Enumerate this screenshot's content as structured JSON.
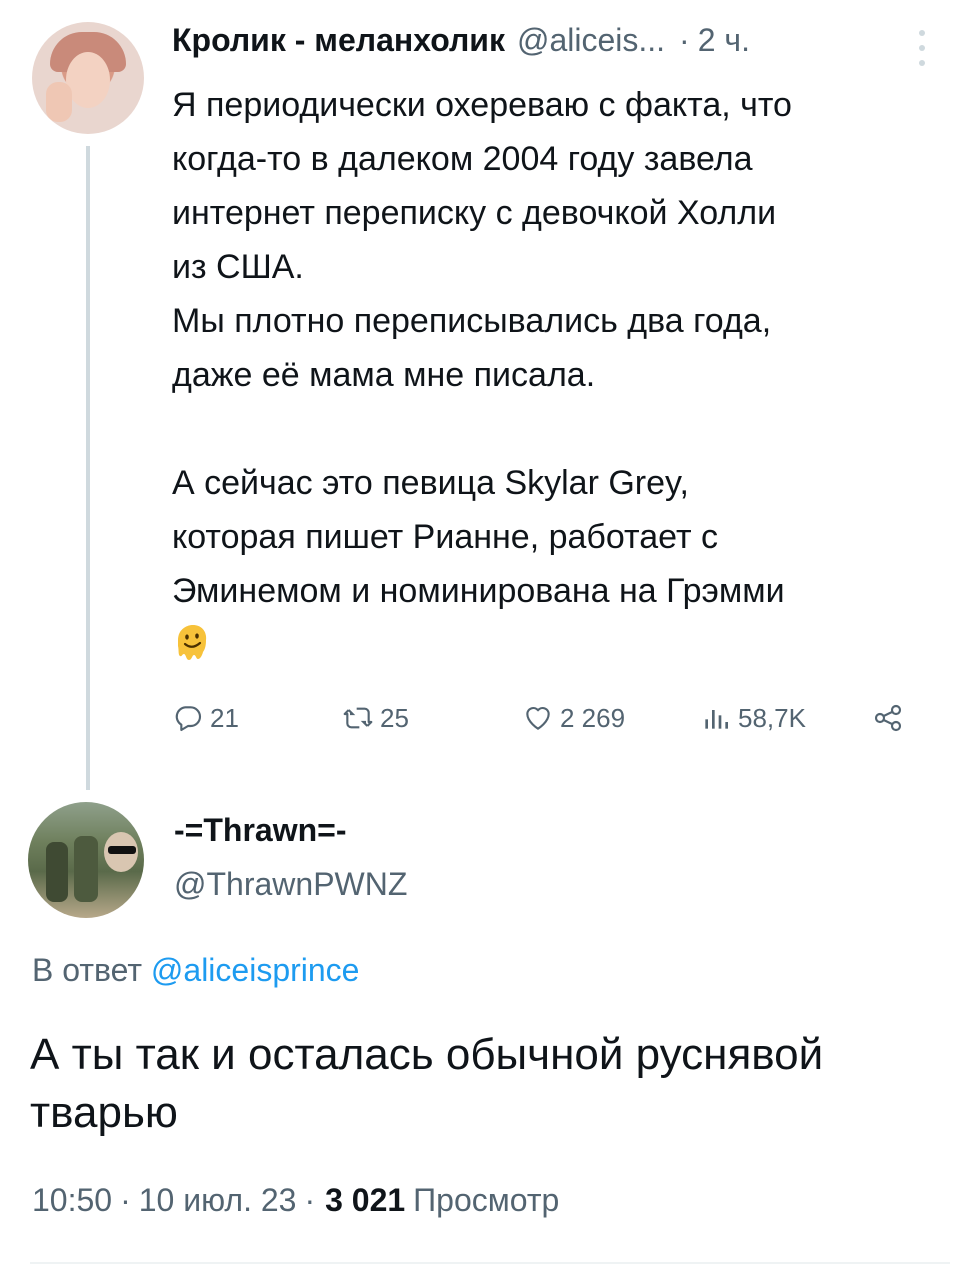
{
  "tweet": {
    "author_name": "Кролик - меланхолик",
    "author_handle": "@aliceis...",
    "time_sep": "·",
    "time": "2 ч.",
    "text_lines": [
      "Я периодически охереваю с факта, что",
      "когда-то в далеком 2004 году завела",
      "интернет переписку с девочкой Холли",
      "из США.",
      "Мы плотно переписывались два года,",
      "даже её мама мне писала.",
      "",
      "А сейчас это певица Skylar Grey,",
      "которая пишет Рианне, работает с",
      "Эминемом и номинирована на Грэмми"
    ],
    "emoji_icon": "melting-face-emoji",
    "actions": {
      "replies": "21",
      "retweets": "25",
      "likes": "2 269",
      "views": "58,7K"
    },
    "icons": [
      "reply-icon",
      "retweet-icon",
      "like-icon",
      "views-icon",
      "share-icon",
      "more-icon"
    ]
  },
  "reply": {
    "author_name": "-=Thrawn=-",
    "author_handle": "@ThrawnPWNZ",
    "reply_to_prefix": "В ответ",
    "reply_to_handle": "@aliceisprince",
    "text_lines": [
      "А ты так и осталась обычной руснявой",
      "тварью"
    ],
    "time": "10:50",
    "sep": "·",
    "date": "10 июл. 23",
    "views_count": "3 021",
    "views_label": "Просмотр"
  },
  "colors": {
    "text": "#0f1419",
    "secondary": "#536471",
    "link": "#1d9bf0",
    "divider": "#cfd9de"
  }
}
